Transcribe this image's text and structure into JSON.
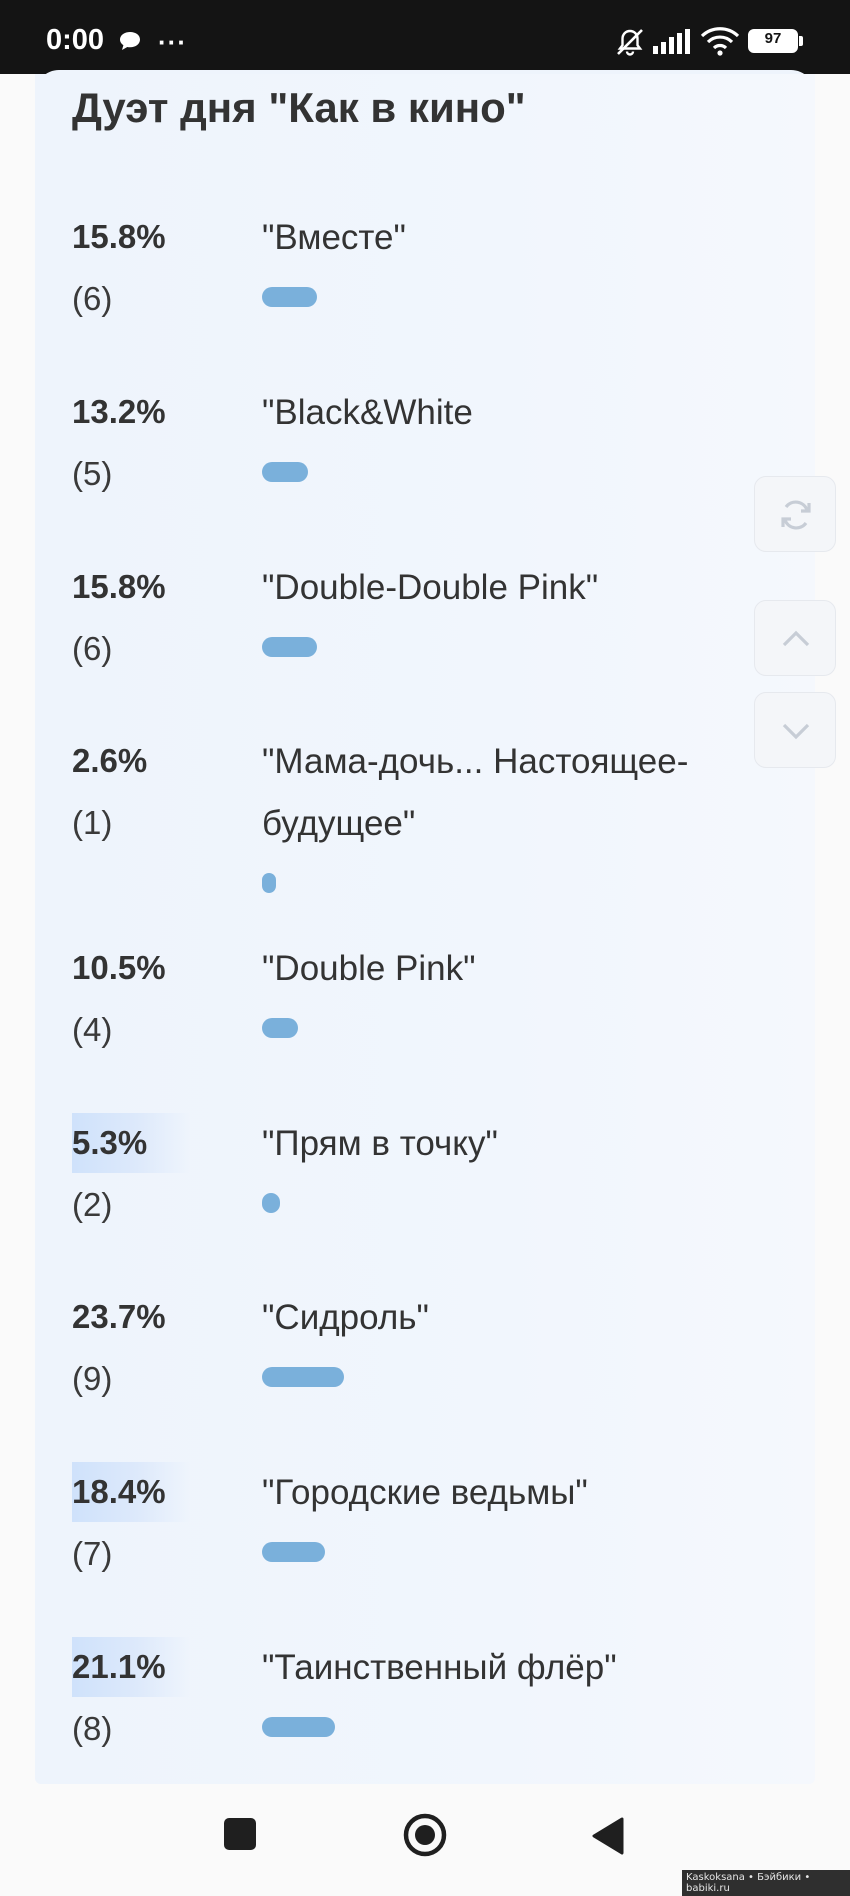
{
  "status_bar": {
    "time": "0:00",
    "dots": "···",
    "battery": "97",
    "icons": [
      "chat-bubble-icon",
      "bell-muted-icon",
      "signal-icon",
      "wifi-icon",
      "battery-icon"
    ]
  },
  "poll": {
    "title": "Дуэт дня \"Как в кино\"",
    "bar_color": "#7ab0db",
    "options": [
      {
        "percent": "15.8%",
        "count": "(6)",
        "label": "\"Вместе\"",
        "value": 15.8,
        "highlight": false
      },
      {
        "percent": "13.2%",
        "count": "(5)",
        "label": "\"Black&White",
        "value": 13.2,
        "highlight": false
      },
      {
        "percent": "15.8%",
        "count": "(6)",
        "label": "\"Double-Double Pink\"",
        "value": 15.8,
        "highlight": false
      },
      {
        "percent": "2.6%",
        "count": "(1)",
        "label": "\"Мама-дочь... Настоящее-будущее\"",
        "value": 2.6,
        "highlight": false
      },
      {
        "percent": "10.5%",
        "count": "(4)",
        "label": "\"Double Pink\"",
        "value": 10.5,
        "highlight": false
      },
      {
        "percent": "5.3%",
        "count": "(2)",
        "label": "\"Прям в точку\"",
        "value": 5.3,
        "highlight": true
      },
      {
        "percent": "23.7%",
        "count": "(9)",
        "label": "\"Сидроль\"",
        "value": 23.7,
        "highlight": false
      },
      {
        "percent": "18.4%",
        "count": "(7)",
        "label": "\"Городские ведьмы\"",
        "value": 18.4,
        "highlight": true
      },
      {
        "percent": "21.1%",
        "count": "(8)",
        "label": "\"Таинственный флёр\"",
        "value": 21.1,
        "highlight": true
      }
    ]
  },
  "side_buttons": [
    "refresh-icon",
    "chevron-up-icon",
    "chevron-down-icon"
  ],
  "nav_bar": [
    "recent-apps-icon",
    "home-icon",
    "back-icon"
  ],
  "watermark": "Kaskoksana • Бэйбики • babiki.ru"
}
